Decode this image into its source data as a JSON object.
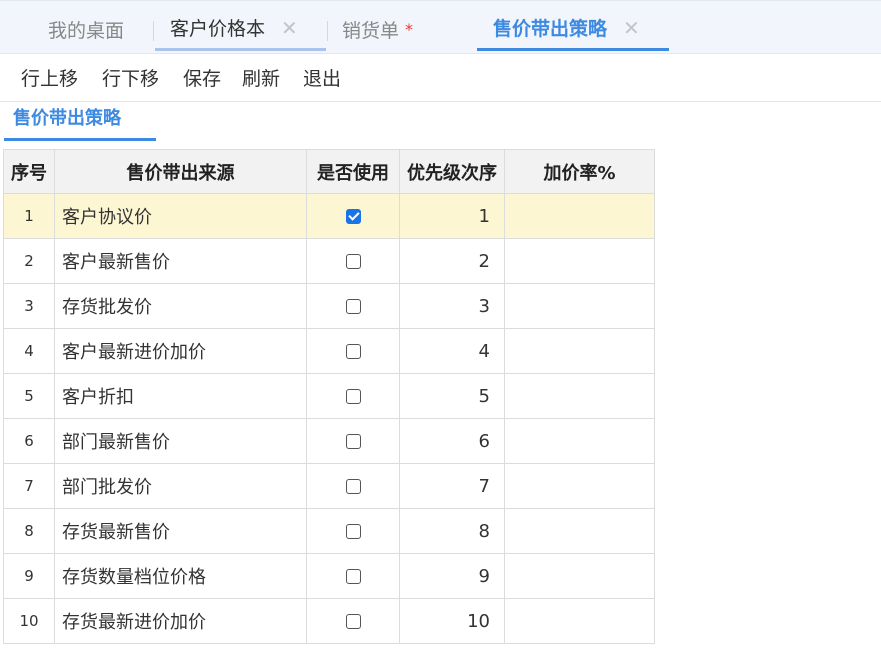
{
  "tabs": [
    {
      "label": "我的桌面"
    },
    {
      "label": "客户价格本",
      "close": "✕"
    },
    {
      "label": "销货单",
      "dirty": "*"
    },
    {
      "label": "售价带出策略",
      "close": "✕"
    }
  ],
  "toolbar": {
    "move_up": "行上移",
    "move_down": "行下移",
    "save": "保存",
    "refresh": "刷新",
    "exit": "退出"
  },
  "section_title": "售价带出策略",
  "columns": {
    "no": "序号",
    "source": "售价带出来源",
    "use": "是否使用",
    "priority": "优先级次序",
    "rate": "加价率%"
  },
  "rows": [
    {
      "no": "1",
      "source": "客户协议价",
      "checked": true,
      "priority": "1",
      "rate": ""
    },
    {
      "no": "2",
      "source": "客户最新售价",
      "checked": false,
      "priority": "2",
      "rate": ""
    },
    {
      "no": "3",
      "source": "存货批发价",
      "checked": false,
      "priority": "3",
      "rate": ""
    },
    {
      "no": "4",
      "source": "客户最新进价加价",
      "checked": false,
      "priority": "4",
      "rate": ""
    },
    {
      "no": "5",
      "source": "客户折扣",
      "checked": false,
      "priority": "5",
      "rate": ""
    },
    {
      "no": "6",
      "source": "部门最新售价",
      "checked": false,
      "priority": "6",
      "rate": ""
    },
    {
      "no": "7",
      "source": "部门批发价",
      "checked": false,
      "priority": "7",
      "rate": ""
    },
    {
      "no": "8",
      "source": "存货最新售价",
      "checked": false,
      "priority": "8",
      "rate": ""
    },
    {
      "no": "9",
      "source": "存货数量档位价格",
      "checked": false,
      "priority": "9",
      "rate": ""
    },
    {
      "no": "10",
      "source": "存货最新进价加价",
      "checked": false,
      "priority": "10",
      "rate": ""
    }
  ]
}
